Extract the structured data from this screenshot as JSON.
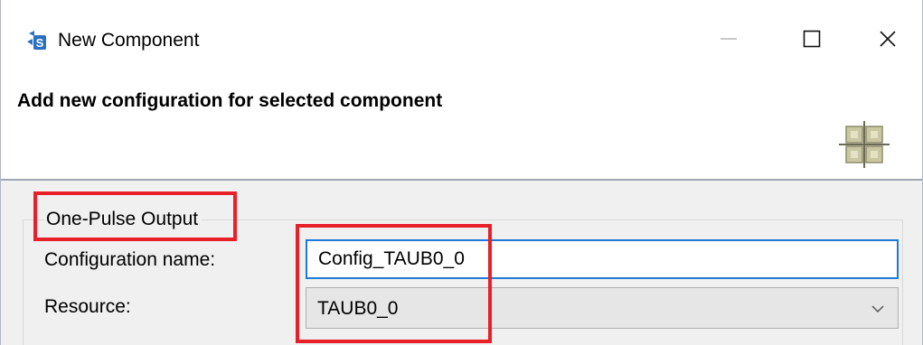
{
  "window": {
    "title": "New Component",
    "app_icon": "renesas-smart-configurator-icon",
    "controls": {
      "minimize_icon": "minimize-icon",
      "maximize_icon": "maximize-icon",
      "close_icon": "close-icon"
    }
  },
  "header": {
    "title": "Add new configuration for selected component",
    "icon": "component-grid-icon"
  },
  "form": {
    "group_label": "One-Pulse Output",
    "configuration_name": {
      "label": "Configuration name:",
      "value": "Config_TAUB0_0"
    },
    "resource": {
      "label": "Resource:",
      "selected": "TAUB0_0",
      "dropdown_icon": "chevron-down-icon"
    }
  },
  "colors": {
    "highlight": "#e8202a",
    "input_focus_border": "#1e7ad6",
    "dialog_body_bg": "#f0f0f0"
  }
}
